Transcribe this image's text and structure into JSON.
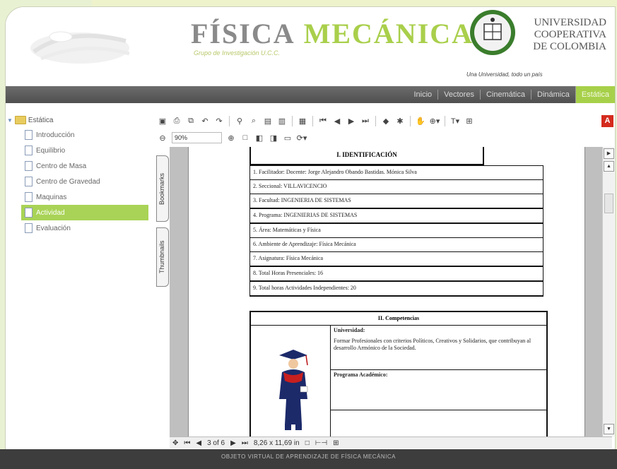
{
  "header": {
    "title_part1": "FÍSICA",
    "title_part2": "MECÁNICA",
    "subtitle": "Grupo de Investigación U.C.C.",
    "university_lines": [
      "UNIVERSIDAD",
      "COOPERATIVA",
      "DE COLOMBIA"
    ],
    "tagline": "Una Universidad, todo un país"
  },
  "nav": {
    "items": [
      "Inicio",
      "Vectores",
      "Cinemática",
      "Dinámica",
      "Estática"
    ],
    "active": "Estática"
  },
  "sidebar": {
    "root": "Estática",
    "items": [
      {
        "label": "Introducción"
      },
      {
        "label": "Equilibrio"
      },
      {
        "label": "Centro de Masa"
      },
      {
        "label": "Centro de Gravedad"
      },
      {
        "label": "Maquinas"
      },
      {
        "label": "Actividad"
      },
      {
        "label": "Evaluación"
      }
    ],
    "selected": "Actividad"
  },
  "viewer": {
    "zoom": "90%",
    "tabs": {
      "bookmarks": "Bookmarks",
      "thumbnails": "Thumbnails"
    },
    "status": {
      "page": "3 of 6",
      "size": "8,26 x 11,69 in"
    }
  },
  "document": {
    "identification_heading": "I.     IDENTIFICACIÓN",
    "rows": [
      "1. Facilitador: Docente: Jorge Alejandro Obando Bastidas.  Mónica Silva",
      "2. Seccional:    VILLAVICENCIO",
      "3. Facultad:     INGENIERIA DE SISTEMAS",
      "4. Programa:    INGENIERIAS DE SISTEMAS",
      "5. Área: Matemáticas y Física",
      "6. Ambiente de Aprendizaje: Física Mecánica",
      "7. Asignatura:    Física Mecánica",
      "8. Total Horas Presenciales:    16",
      "9. Total horas Actividades Independientes:    20"
    ],
    "competencies_heading": "II. Competencias",
    "university_label": "Universidad:",
    "university_text": "Formar Profesionales con criterios Políticos, Creativos y Solidarios, que contribuyan al desarrollo Armónico de la Sociedad.",
    "program_label": "Programa Académico:"
  },
  "footer": {
    "text": "OBJETO VIRTUAL DE APRENDIZAJE DE FÍSICA MECÁNICA"
  },
  "colors": {
    "accent_green": "#a9cf4b",
    "nav_dark": "#555555",
    "adobe_red": "#d42b1e"
  }
}
